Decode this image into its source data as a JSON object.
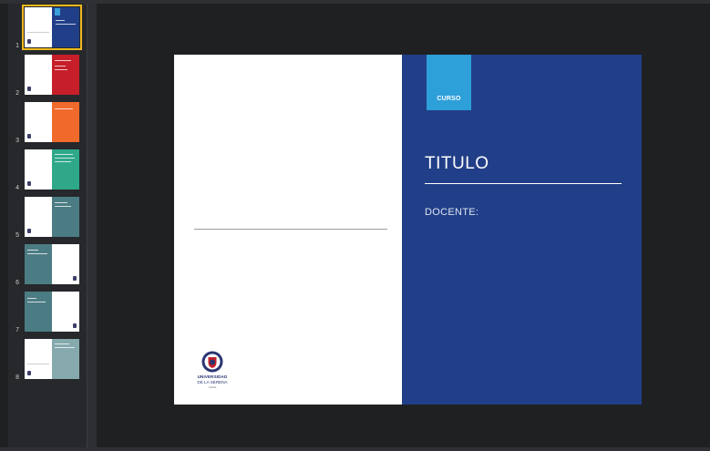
{
  "sidebar": {
    "thumbnails": [
      {
        "number": "1",
        "accent": "#213f88",
        "selected": true
      },
      {
        "number": "2",
        "accent": "#c61f2a",
        "selected": false
      },
      {
        "number": "3",
        "accent": "#f06a2c",
        "selected": false
      },
      {
        "number": "4",
        "accent": "#2fa88a",
        "selected": false
      },
      {
        "number": "5",
        "accent": "#4c7c83",
        "selected": false
      },
      {
        "number": "6",
        "accent": "#4c7c83",
        "selected": false
      },
      {
        "number": "7",
        "accent": "#4c7c83",
        "selected": false
      },
      {
        "number": "8",
        "accent": "#86a9ad",
        "selected": false
      }
    ]
  },
  "slide": {
    "course_label": "CURSO",
    "title": "TITULO",
    "teacher_label": "DOCENTE:",
    "logo": {
      "line1": "UNIVERSIDAD",
      "line2": "DE LA SERENA",
      "line3": "CHILE"
    },
    "colors": {
      "panel": "#213f88",
      "tag": "#2d9fd9",
      "selection": "#f0b91c"
    }
  }
}
